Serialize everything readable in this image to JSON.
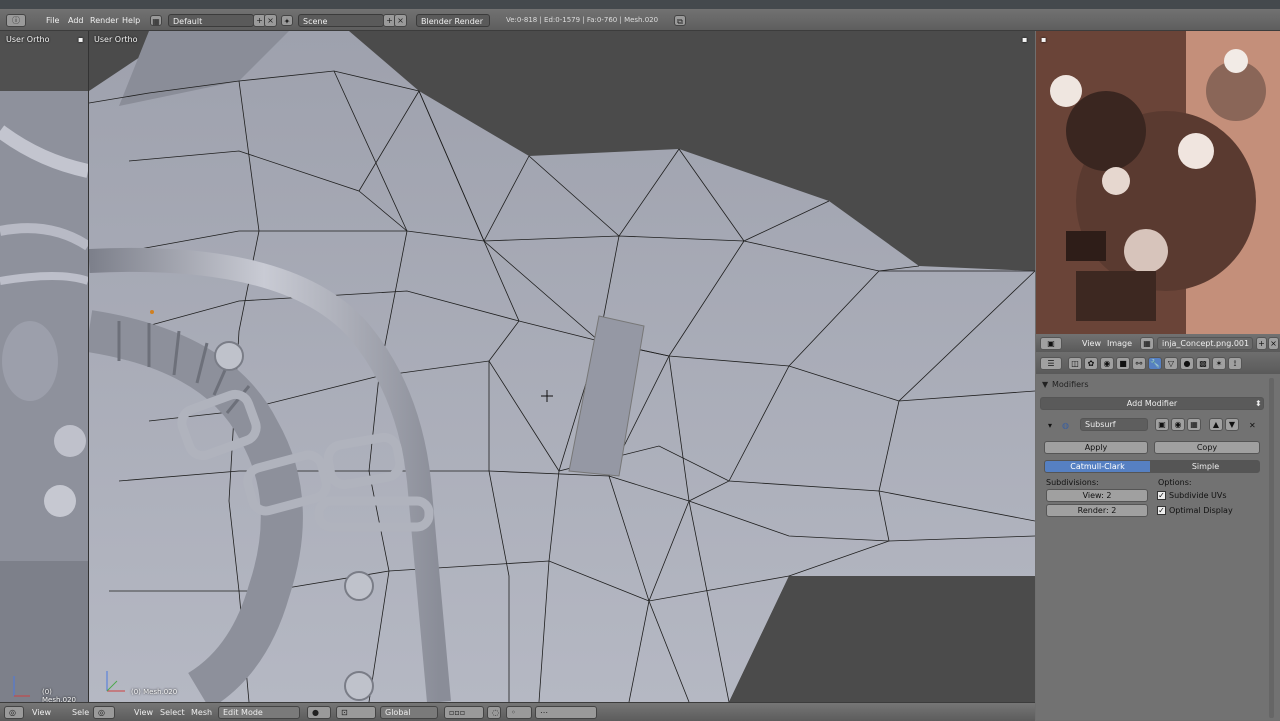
{
  "header": {
    "menu": [
      "File",
      "Add",
      "Render",
      "Help"
    ],
    "screen_layout": "Default",
    "scene": "Scene",
    "render_engine": "Blender Render",
    "stats": "Ve:0-818 | Ed:0-1579 | Fa:0-760 | Mesh.020"
  },
  "left_viewport": {
    "label": "User Ortho",
    "object_label": "(0) Mesh.020"
  },
  "main_viewport": {
    "label": "User Ortho",
    "object_label": "(0) Mesh.020"
  },
  "bottom_header": {
    "left_menu": [
      "View",
      "Sele"
    ],
    "menu": [
      "View",
      "Select",
      "Mesh"
    ],
    "mode": "Edit Mode",
    "orientation": "Global"
  },
  "image_editor": {
    "menu": [
      "View",
      "Image"
    ],
    "image_name": "inja_Concept.png.001"
  },
  "modifiers": {
    "panel_title": "Modifiers",
    "add_button": "Add Modifier",
    "modifier_name": "Subsurf",
    "apply_button": "Apply",
    "copy_button": "Copy",
    "type_options": [
      "Catmull-Clark",
      "Simple"
    ],
    "active_type": "Catmull-Clark",
    "subdivisions_label": "Subdivisions:",
    "view_field": "View: 2",
    "render_field": "Render: 2",
    "options_label": "Options:",
    "subdivide_uvs": "Subdivide UVs",
    "optimal_display": "Optimal Display"
  },
  "colors": {
    "viewport_bg": "#4b4b4b",
    "mesh": "#a9acb8",
    "active_tab": "#5680c2"
  }
}
